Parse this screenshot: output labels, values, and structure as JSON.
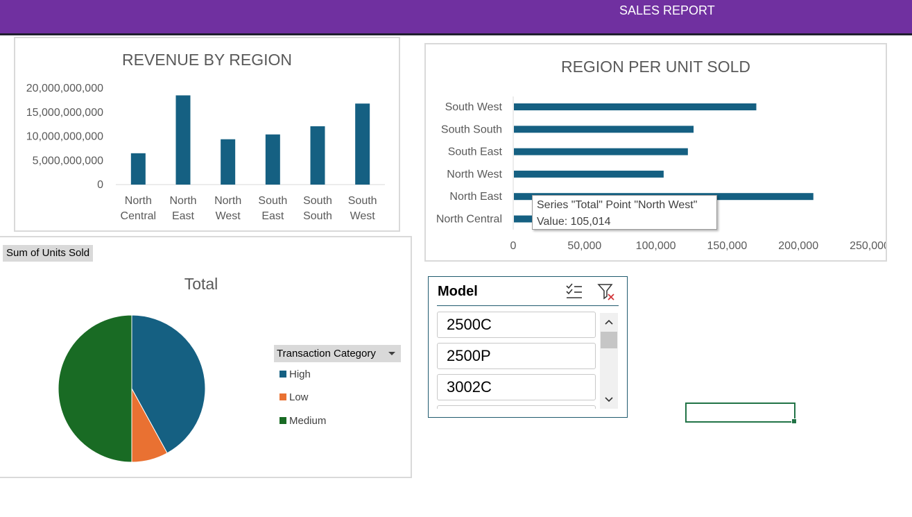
{
  "header": {
    "title": "SALES REPORT",
    "color": "#7030a0"
  },
  "revenue_chart": {
    "title": "REVENUE BY REGION",
    "y_ticks": [
      "20,000,000,000",
      "15,000,000,000",
      "10,000,000,000",
      "5,000,000,000",
      "0"
    ],
    "categories": [
      {
        "line1": "North",
        "line2": "Central"
      },
      {
        "line1": "North",
        "line2": "East"
      },
      {
        "line1": "North",
        "line2": "West"
      },
      {
        "line1": "South",
        "line2": "East"
      },
      {
        "line1": "South",
        "line2": "South"
      },
      {
        "line1": "South",
        "line2": "West"
      }
    ]
  },
  "unit_chart": {
    "title": "REGION PER UNIT SOLD",
    "categories": [
      "South West",
      "South South",
      "South East",
      "North West",
      "North East",
      "North Central"
    ],
    "x_ticks": [
      "0",
      "50,000",
      "100,000",
      "150,000",
      "200,000",
      "250,000"
    ]
  },
  "tooltip": {
    "line1": "Series \"Total\" Point \"North West\"",
    "line2": "Value: 105,014"
  },
  "pivot": {
    "field_button": "Sum of Units Sold"
  },
  "pie_chart": {
    "title": "Total",
    "legend_filter": "Transaction Category",
    "legend": [
      {
        "label": "High",
        "color": "#156082"
      },
      {
        "label": "Low",
        "color": "#e97132"
      },
      {
        "label": "Medium",
        "color": "#196b24"
      }
    ]
  },
  "slicer": {
    "title": "Model",
    "items": [
      "2500C",
      "2500P",
      "3002C"
    ]
  },
  "chart_data": [
    {
      "type": "bar",
      "title": "REVENUE BY REGION",
      "categories": [
        "North Central",
        "North East",
        "North West",
        "South East",
        "South South",
        "South West"
      ],
      "values": [
        6500000000,
        18500000000,
        9400000000,
        10400000000,
        12100000000,
        16800000000
      ],
      "ylim": [
        0,
        20000000000
      ],
      "color": "#156082",
      "grid": false
    },
    {
      "type": "bar",
      "orientation": "horizontal",
      "title": "REGION PER UNIT SOLD",
      "categories": [
        "North Central",
        "North East",
        "North West",
        "South East",
        "South South",
        "South West"
      ],
      "series": [
        {
          "name": "Total",
          "values": [
            14000,
            210000,
            105014,
            122000,
            126000,
            170000
          ]
        }
      ],
      "xlim": [
        0,
        250000
      ],
      "color": "#156082",
      "grid": false
    },
    {
      "type": "pie",
      "title": "Total",
      "labels": [
        "High",
        "Low",
        "Medium"
      ],
      "values": [
        42,
        8,
        50
      ],
      "colors": [
        "#156082",
        "#e97132",
        "#196b24"
      ],
      "legend": "right"
    }
  ]
}
